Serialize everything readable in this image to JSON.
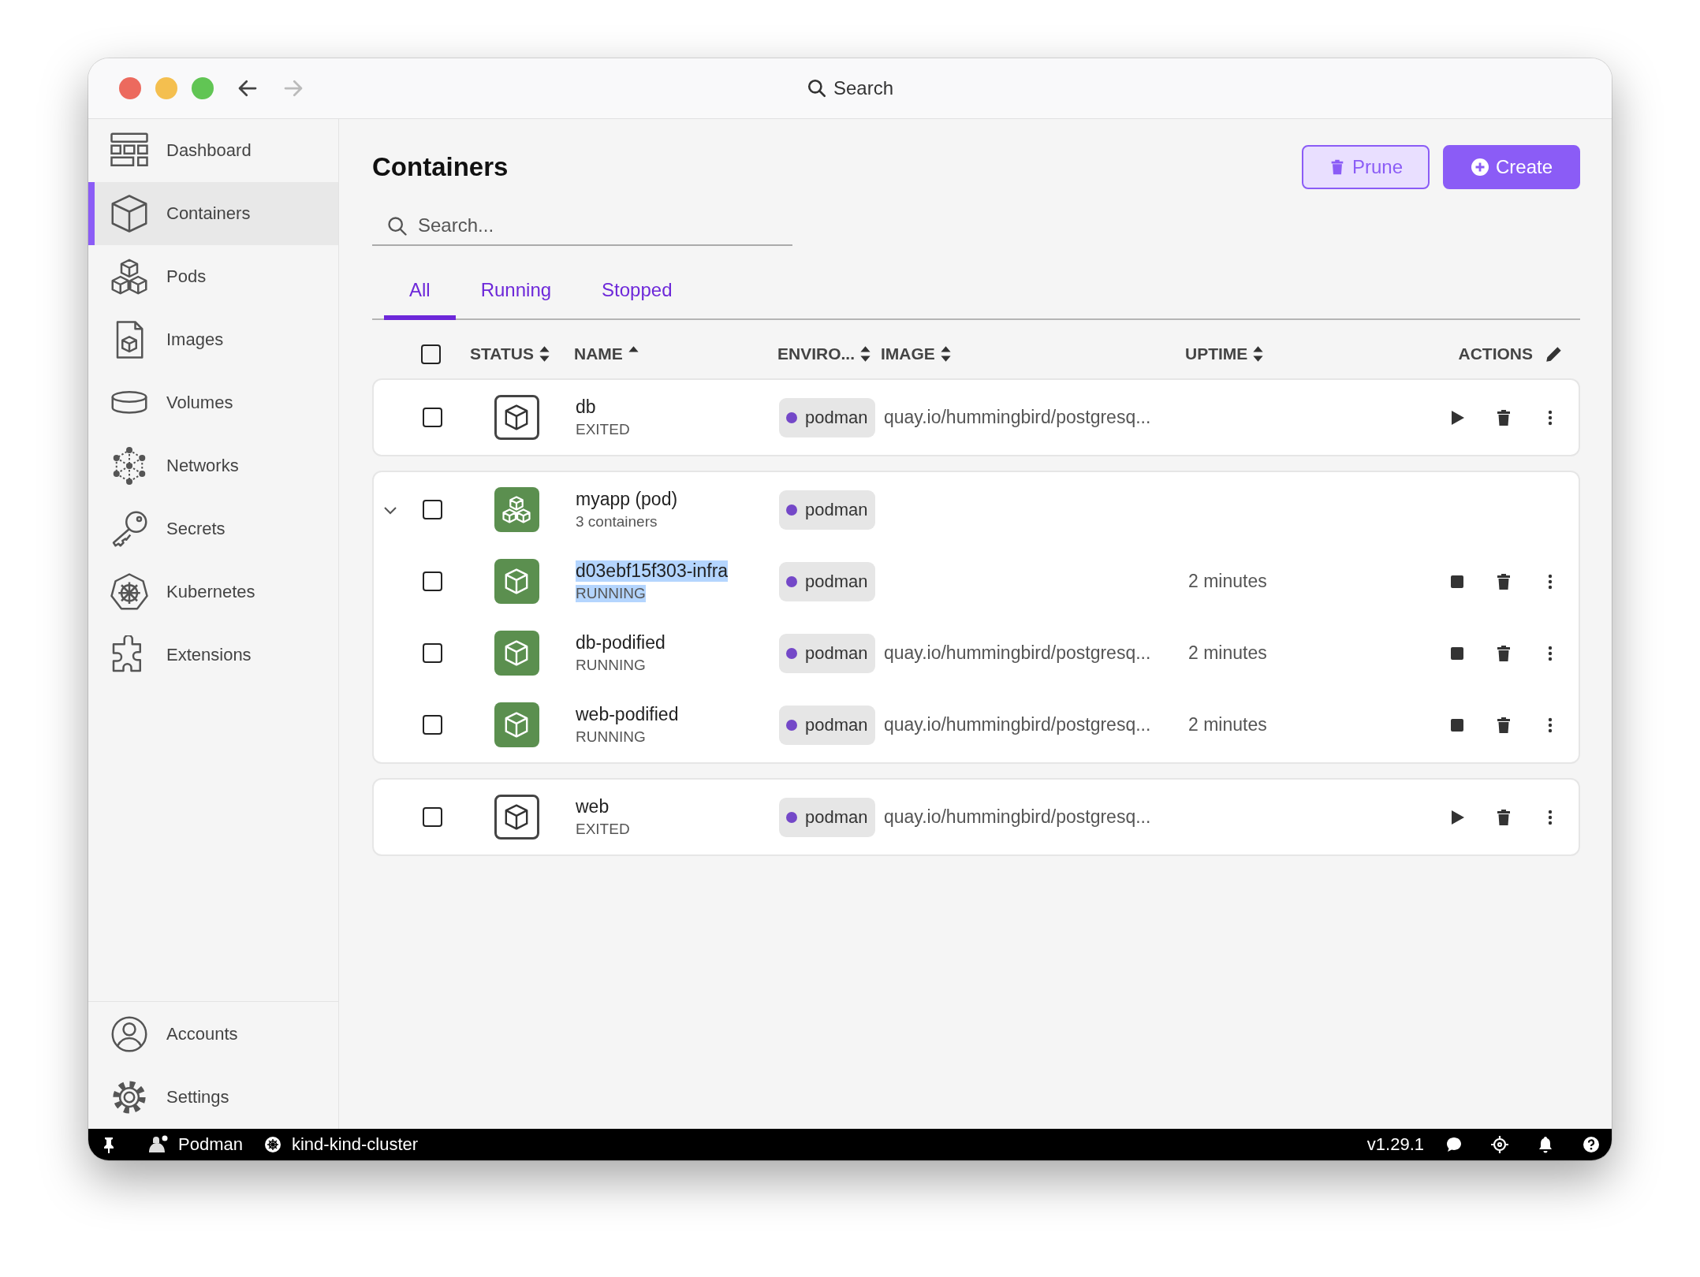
{
  "titlebar": {
    "back_enabled": true,
    "forward_enabled": false,
    "search_label": "Search"
  },
  "sidebar": {
    "items": [
      {
        "label": "Dashboard",
        "selected": false
      },
      {
        "label": "Containers",
        "selected": true
      },
      {
        "label": "Pods",
        "selected": false
      },
      {
        "label": "Images",
        "selected": false
      },
      {
        "label": "Volumes",
        "selected": false
      },
      {
        "label": "Networks",
        "selected": false
      },
      {
        "label": "Secrets",
        "selected": false
      },
      {
        "label": "Kubernetes",
        "selected": false
      },
      {
        "label": "Extensions",
        "selected": false
      }
    ],
    "bottom_items": [
      {
        "label": "Accounts",
        "selected": false
      },
      {
        "label": "Settings",
        "selected": false
      }
    ]
  },
  "page": {
    "title": "Containers",
    "buttons": [
      {
        "label": "Prune",
        "kind": "prune"
      },
      {
        "label": "Create",
        "kind": "create"
      }
    ],
    "search": {
      "placeholder": "Search..."
    },
    "tabs": [
      {
        "label": "All",
        "selected": true
      },
      {
        "label": "Running",
        "selected": false
      },
      {
        "label": "Stopped",
        "selected": false
      }
    ]
  },
  "table": {
    "select_all_checked": false,
    "columns": [
      {
        "label": "STATUS",
        "kind": "sort",
        "sorted": false
      },
      {
        "label": "NAME",
        "kind": "sort",
        "sorted": true
      },
      {
        "label": "ENVIRO...",
        "kind": "sort",
        "sorted": false
      },
      {
        "label": "IMAGE",
        "kind": "sort",
        "sorted": false
      },
      {
        "label": "UPTIME",
        "kind": "sort",
        "sorted": false
      },
      {
        "label": "ACTIONS",
        "kind": "actions"
      }
    ],
    "groups": [
      {
        "kind": "container",
        "name": "db",
        "status": "EXITED",
        "running": false,
        "environment": "podman",
        "image": "quay.io/hummingbird/postgresq...",
        "checked": false,
        "highlighted": false
      },
      {
        "kind": "pod",
        "name": "myapp (pod)",
        "status": "3 containers",
        "running": true,
        "environment": "podman",
        "checked": false,
        "expanded": true,
        "highlighted": false,
        "children": [
          {
            "name": "d03ebf15f303-infra",
            "status": "RUNNING",
            "running": true,
            "environment": "podman",
            "uptime": "2 minutes",
            "checked": false,
            "highlighted": true
          },
          {
            "name": "db-podified",
            "status": "RUNNING",
            "running": true,
            "environment": "podman",
            "image": "quay.io/hummingbird/postgresq...",
            "uptime": "2 minutes",
            "checked": false,
            "highlighted": false
          },
          {
            "name": "web-podified",
            "status": "RUNNING",
            "running": true,
            "environment": "podman",
            "image": "quay.io/hummingbird/postgresq...",
            "uptime": "2 minutes",
            "checked": false,
            "highlighted": false
          }
        ]
      },
      {
        "kind": "container",
        "name": "web",
        "status": "EXITED",
        "running": false,
        "environment": "podman",
        "image": "quay.io/hummingbird/postgresq...",
        "checked": false,
        "highlighted": false
      }
    ]
  },
  "status_bar": {
    "engine": "Podman",
    "context": "kind-kind-cluster",
    "version": "v1.29.1"
  }
}
